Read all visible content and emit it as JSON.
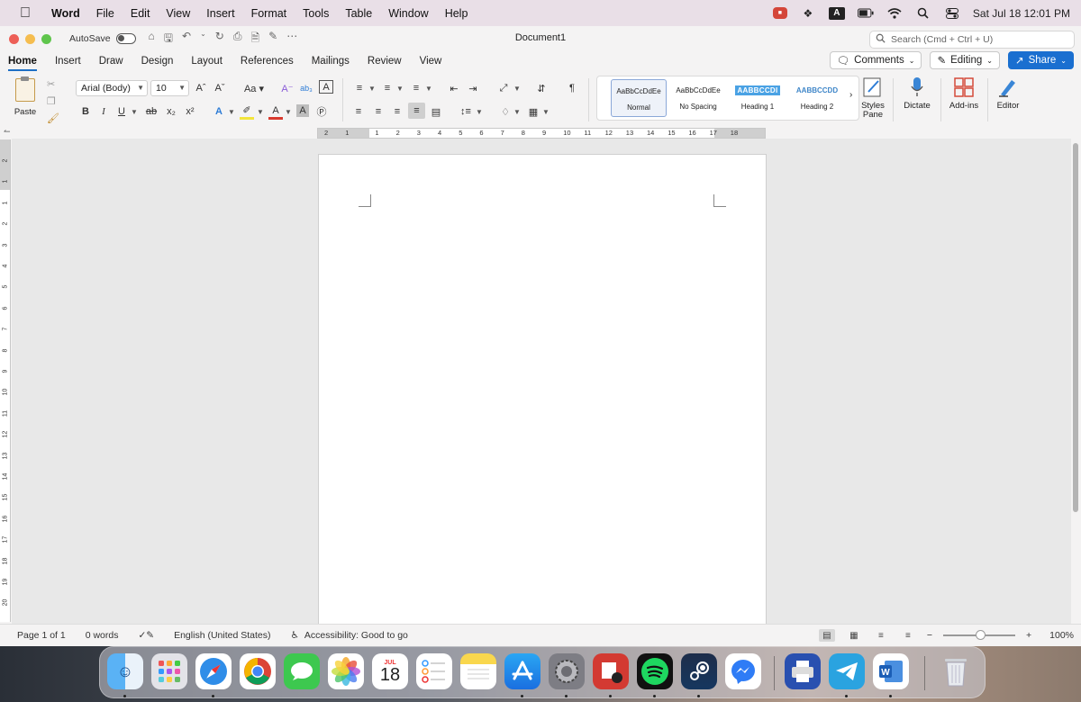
{
  "menubar": {
    "app_name": "Word",
    "items": [
      "File",
      "Edit",
      "View",
      "Insert",
      "Format",
      "Tools",
      "Table",
      "Window",
      "Help"
    ],
    "date_time": "Sat Jul 18  12:01 PM",
    "input_source": "A"
  },
  "window": {
    "title": "Document1",
    "autosave_label": "AutoSave",
    "search_placeholder": "Search (Cmd + Ctrl + U)"
  },
  "tabs": [
    "Home",
    "Insert",
    "Draw",
    "Design",
    "Layout",
    "References",
    "Mailings",
    "Review",
    "View"
  ],
  "tab_actions": {
    "comments": "Comments",
    "editing": "Editing",
    "share": "Share"
  },
  "ribbon": {
    "paste_label": "Paste",
    "font_name": "Arial (Body)",
    "font_size": "10",
    "styles": [
      {
        "sample": "AaBbCcDdEe",
        "name": "Normal"
      },
      {
        "sample": "AaBbCcDdEe",
        "name": "No Spacing"
      },
      {
        "sample": "AABBCCDI",
        "name": "Heading 1"
      },
      {
        "sample": "AABBCCDD",
        "name": "Heading 2"
      }
    ],
    "styles_pane": "Styles Pane",
    "dictate": "Dictate",
    "addins": "Add-ins",
    "editor": "Editor"
  },
  "ruler": {
    "h_ticks": [
      "2",
      "1",
      "1",
      "2",
      "3",
      "4",
      "5",
      "6",
      "7",
      "8",
      "9",
      "10",
      "11",
      "12",
      "13",
      "14",
      "15",
      "16",
      "17",
      "18"
    ],
    "v_ticks": [
      "2",
      "1",
      "1",
      "2",
      "3",
      "4",
      "5",
      "6",
      "7",
      "8",
      "9",
      "10",
      "11",
      "12",
      "13",
      "14",
      "15",
      "16",
      "17",
      "18",
      "19",
      "20"
    ]
  },
  "statusbar": {
    "page": "Page 1 of 1",
    "words": "0 words",
    "language": "English (United States)",
    "accessibility": "Accessibility: Good to go",
    "zoom": "100%"
  },
  "dock": {
    "calendar_month": "JUL",
    "calendar_day": "18",
    "apps": [
      "Finder",
      "Launchpad",
      "Safari",
      "Chrome",
      "Messages",
      "Photos",
      "Calendar",
      "Reminders",
      "Notes",
      "App Store",
      "System Settings",
      "Photo Booth",
      "Spotify",
      "Steam",
      "Messenger",
      "Print Queue",
      "Telegram",
      "Microsoft Word",
      "Trash"
    ]
  }
}
